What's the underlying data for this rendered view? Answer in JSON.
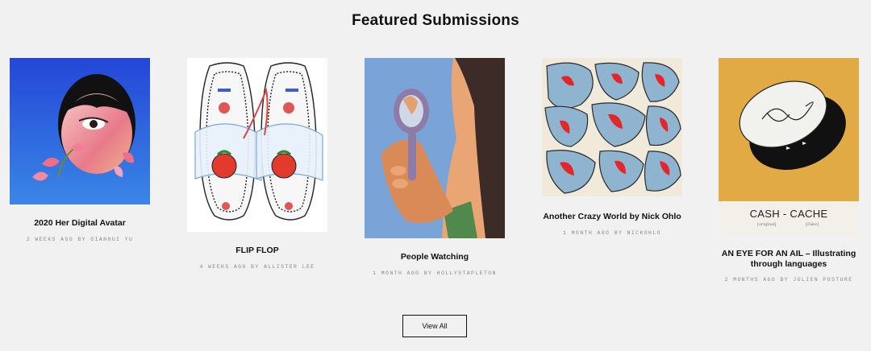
{
  "section": {
    "title": "Featured Submissions"
  },
  "submissions": [
    {
      "title": "2020 Her Digital Avatar",
      "meta": "2 weeks ago by Gianhui Yu"
    },
    {
      "title": "FLIP FLOP",
      "meta": "4 weeks ago by Allister Lee"
    },
    {
      "title": "People Watching",
      "meta": "1 month ago by hollystapleton"
    },
    {
      "title": "Another Crazy World by Nick Ohlo",
      "meta": "1 month ago by nickohlo"
    },
    {
      "title": "AN EYE FOR AN AIL – Illustrating through languages",
      "meta": "2 months ago by Julien Posture",
      "art_text": "CASH - CACHE",
      "art_sub_left": "[original]",
      "art_sub_right": "[Fake]"
    }
  ],
  "view_all_label": "View All"
}
